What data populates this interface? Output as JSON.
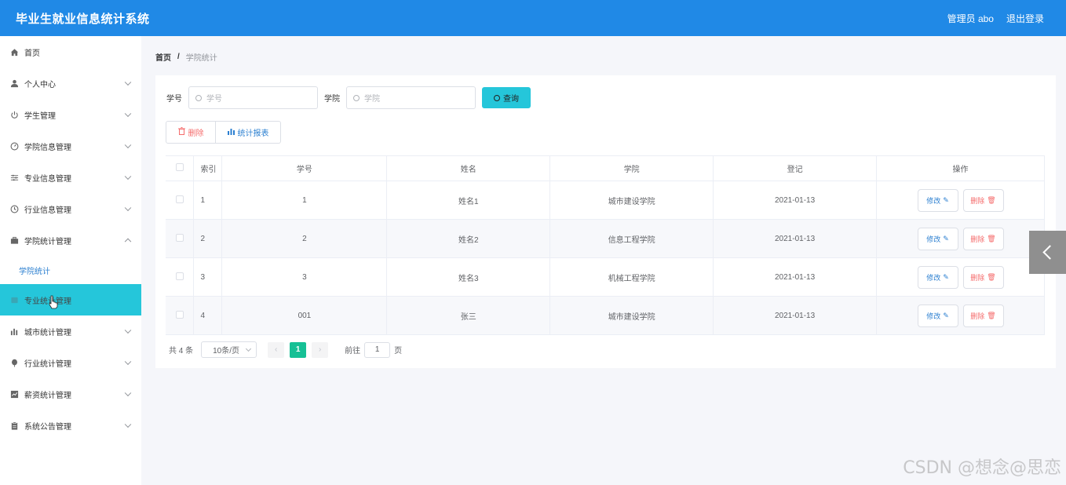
{
  "header": {
    "title": "毕业生就业信息统计系统",
    "admin": "管理员 abo",
    "logout": "退出登录"
  },
  "sidebar": {
    "items": [
      {
        "label": "首页",
        "icon": "home-icon",
        "has_children": false
      },
      {
        "label": "个人中心",
        "icon": "user-icon",
        "has_children": true
      },
      {
        "label": "学生管理",
        "icon": "power-icon",
        "has_children": true
      },
      {
        "label": "学院信息管理",
        "icon": "gauge-icon",
        "has_children": true
      },
      {
        "label": "专业信息管理",
        "icon": "sliders-icon",
        "has_children": true
      },
      {
        "label": "行业信息管理",
        "icon": "clock-icon",
        "has_children": true
      },
      {
        "label": "学院统计管理",
        "icon": "briefcase-icon",
        "has_children": true,
        "expanded": true,
        "sub": "学院统计"
      },
      {
        "label": "专业统计管理",
        "icon": "box-icon",
        "has_children": true,
        "active": true
      },
      {
        "label": "城市统计管理",
        "icon": "bar-chart-icon",
        "has_children": true
      },
      {
        "label": "行业统计管理",
        "icon": "balloon-icon",
        "has_children": true
      },
      {
        "label": "薪资统计管理",
        "icon": "chart-box-icon",
        "has_children": true
      },
      {
        "label": "系统公告管理",
        "icon": "clipboard-icon",
        "has_children": true
      }
    ]
  },
  "breadcrumb": {
    "home": "首页",
    "sep": "/",
    "current": "学院统计"
  },
  "search": {
    "student_id_label": "学号",
    "student_id_placeholder": "学号",
    "college_label": "学院",
    "college_placeholder": "学院",
    "query_button": "查询"
  },
  "actions": {
    "delete": "删除",
    "report": "统计报表"
  },
  "table": {
    "headers": [
      "索引",
      "学号",
      "姓名",
      "学院",
      "登记",
      "操作"
    ],
    "rows": [
      {
        "index": "1",
        "student_id": "1",
        "name": "姓名1",
        "college": "城市建设学院",
        "date": "2021-01-13"
      },
      {
        "index": "2",
        "student_id": "2",
        "name": "姓名2",
        "college": "信息工程学院",
        "date": "2021-01-13"
      },
      {
        "index": "3",
        "student_id": "3",
        "name": "姓名3",
        "college": "机械工程学院",
        "date": "2021-01-13"
      },
      {
        "index": "4",
        "student_id": "001",
        "name": "张三",
        "college": "城市建设学院",
        "date": "2021-01-13"
      }
    ],
    "edit_label": "修改",
    "delete_label": "删除"
  },
  "pager": {
    "total": "共 4 条",
    "page_size": "10条/页",
    "current_page": "1",
    "goto_label": "前往",
    "goto_value": "1",
    "page_suffix": "页"
  },
  "watermark": "CSDN @想念@思恋",
  "colors": {
    "header": "#2089e6",
    "accent": "#25c6da",
    "page_active": "#16c095",
    "danger": "#f56c6c",
    "link": "#2b7fd0"
  }
}
